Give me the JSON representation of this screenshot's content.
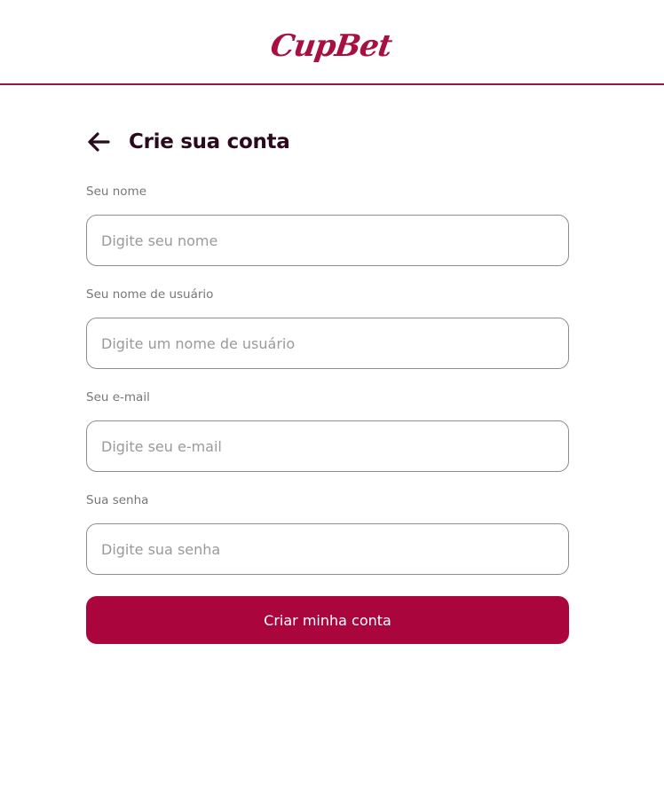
{
  "brand": {
    "logo_text": "CupBet",
    "color": "#a8103f"
  },
  "page": {
    "title": "Crie sua conta",
    "back_icon": "arrow-left-icon"
  },
  "form": {
    "name": {
      "label": "Seu nome",
      "placeholder": "Digite seu nome",
      "value": ""
    },
    "username": {
      "label": "Seu nome de usuário",
      "placeholder": "Digite um nome de usuário",
      "value": ""
    },
    "email": {
      "label": "Seu e-mail",
      "placeholder": "Digite seu e-mail",
      "value": ""
    },
    "password": {
      "label": "Sua senha",
      "placeholder": "Digite sua senha",
      "value": ""
    },
    "submit_label": "Criar minha conta"
  },
  "colors": {
    "accent": "#aa063d",
    "header_border": "#8f1b3f",
    "title": "#2b0a1e"
  }
}
